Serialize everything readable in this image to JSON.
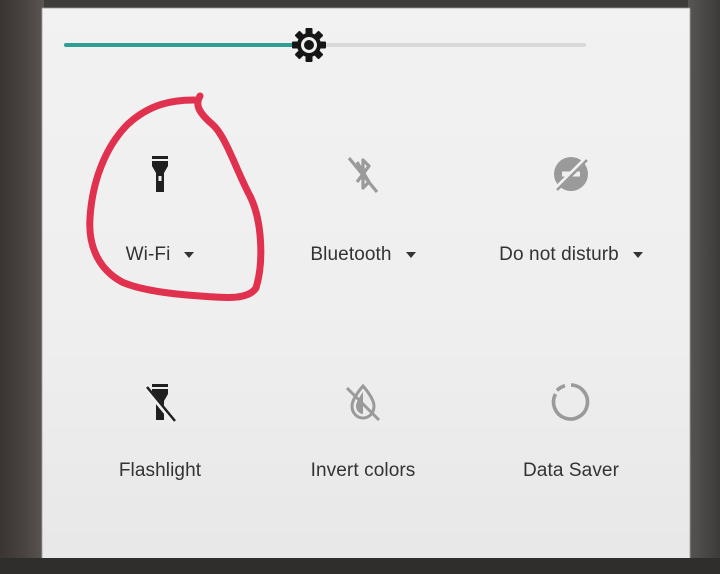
{
  "brightness": {
    "level_fraction": 0.47,
    "thumb_icon": "brightness-gear-icon",
    "fill_color": "#2f9e93",
    "track_color": "#d8d8d8"
  },
  "tiles_row1": [
    {
      "label": "Wi-Fi",
      "icon": "flashlight-icon",
      "has_dropdown": true
    },
    {
      "label": "Bluetooth",
      "icon": "bluetooth-off-icon",
      "has_dropdown": true
    },
    {
      "label": "Do not disturb",
      "icon": "do-not-disturb-off-icon",
      "has_dropdown": true
    }
  ],
  "tiles_row2": [
    {
      "label": "Flashlight",
      "icon": "flashlight-off-icon",
      "has_dropdown": false
    },
    {
      "label": "Invert colors",
      "icon": "invert-colors-off-icon",
      "has_dropdown": false
    },
    {
      "label": "Data Saver",
      "icon": "data-saver-icon",
      "has_dropdown": false
    }
  ],
  "annotation": {
    "shape": "hand-drawn circle around Wi-Fi tile",
    "color": "#e0314f"
  },
  "colors": {
    "panel": "#f1f0f0",
    "icon_active": "#1f1f1f",
    "icon_inactive": "#9a9a9a",
    "label": "#333333"
  }
}
